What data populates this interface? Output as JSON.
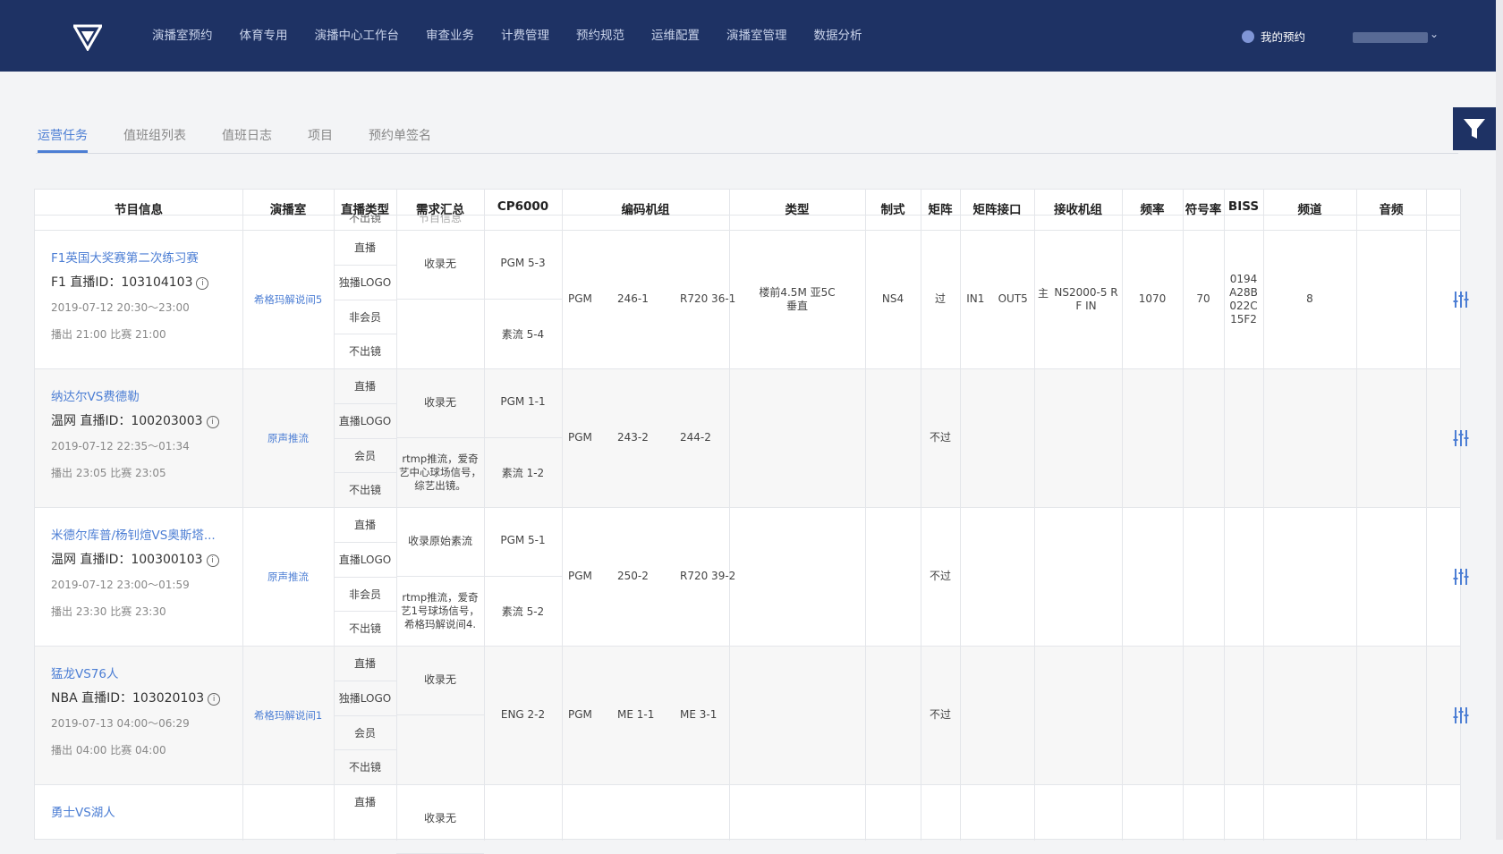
{
  "nav": {
    "items": [
      "演播室预约",
      "体育专用",
      "演播中心工作台",
      "审查业务",
      "计费管理",
      "预约规范",
      "运维配置",
      "演播室管理",
      "数据分析"
    ],
    "my_reservation": "我的预约"
  },
  "tabs": [
    "运营任务",
    "值班组列表",
    "值班日志",
    "项目",
    "预约单签名"
  ],
  "table": {
    "headers": [
      "节目信息",
      "演播室",
      "直播类型",
      "需求汇总",
      "CP6000",
      "编码机组",
      "类型",
      "制式",
      "矩阵",
      "矩阵接口",
      "接收机组",
      "频率",
      "符号率",
      "BISS",
      "频道",
      "音频"
    ],
    "cut_top": {
      "type": "不出镜",
      "req": "节目信息"
    },
    "rows": [
      {
        "title": "F1英国大奖赛第二次练习赛",
        "tag": "F1",
        "id_label": "直播ID：",
        "id": "103104103",
        "time": "2019-07-12 20:30～23:00",
        "play": "播出 21:00",
        "match": "比赛 21:00",
        "studio": "希格玛解说间5",
        "types": [
          "直播",
          "独播LOGO",
          "非会员",
          "不出镜"
        ],
        "req1": "收录无",
        "req2": "",
        "cp_top": {
          "label": "PGM",
          "value": "5-3"
        },
        "cp_bot": {
          "label": "素流",
          "value": "5-4"
        },
        "enc": {
          "a": "PGM",
          "b": "246-1",
          "c": "R720 36-1"
        },
        "kind": "楼前4.5M 亚5C\n垂直",
        "format": "NS4",
        "matrix": "过",
        "mif": {
          "in": "IN1",
          "out": "OUT5"
        },
        "recv": {
          "pre": "主",
          "val": "NS2000-5 R\nF IN"
        },
        "freq": "1070",
        "symrate": "70",
        "biss": "0194\nA28B\n022C\n15F2",
        "channel": "8",
        "audio": ""
      },
      {
        "title": "纳达尔VS费德勒",
        "tag": "温网",
        "id_label": "直播ID：",
        "id": "100203003",
        "time": "2019-07-12 22:35～01:34",
        "play": "播出 23:05",
        "match": "比赛 23:05",
        "studio": "原声推流",
        "types": [
          "直播",
          "直播LOGO",
          "会员",
          "不出镜"
        ],
        "req1": "收录无",
        "req2": "rtmp推流，爱奇\n艺中心球场信号，\n综艺出镜。",
        "cp_top": {
          "label": "PGM",
          "value": "1-1"
        },
        "cp_bot": {
          "label": "素流",
          "value": "1-2"
        },
        "enc": {
          "a": "PGM",
          "b": "243-2",
          "c": "244-2"
        },
        "kind": "",
        "format": "",
        "matrix": "不过",
        "mif": {
          "in": "",
          "out": ""
        },
        "recv": {
          "pre": "",
          "val": ""
        },
        "freq": "",
        "symrate": "",
        "biss": "",
        "channel": "",
        "audio": ""
      },
      {
        "title": "米德尔库普/杨钊煊VS奥斯塔...",
        "tag": "温网",
        "id_label": "直播ID：",
        "id": "100300103",
        "time": "2019-07-12 23:00～01:59",
        "play": "播出 23:30",
        "match": "比赛 23:30",
        "studio": "原声推流",
        "types": [
          "直播",
          "直播LOGO",
          "非会员",
          "不出镜"
        ],
        "req1": "收录原始素流",
        "req2": "rtmp推流，爱奇\n艺1号球场信号，\n希格玛解说间4.",
        "cp_top": {
          "label": "PGM",
          "value": "5-1"
        },
        "cp_bot": {
          "label": "素流",
          "value": "5-2"
        },
        "enc": {
          "a": "PGM",
          "b": "250-2",
          "c": "R720 39-2"
        },
        "kind": "",
        "format": "",
        "matrix": "不过",
        "mif": {
          "in": "",
          "out": ""
        },
        "recv": {
          "pre": "",
          "val": ""
        },
        "freq": "",
        "symrate": "",
        "biss": "",
        "channel": "",
        "audio": ""
      },
      {
        "title": "猛龙VS76人",
        "tag": "NBA",
        "id_label": "直播ID：",
        "id": "103020103",
        "time": "2019-07-13 04:00～06:29",
        "play": "播出 04:00",
        "match": "比赛 04:00",
        "studio": "希格玛解说间1",
        "types": [
          "直播",
          "独播LOGO",
          "会员",
          "不出镜"
        ],
        "req1": "收录无",
        "req2": "",
        "cp_single": {
          "label": "ENG",
          "value": "2-2"
        },
        "enc": {
          "a": "PGM",
          "b": "ME 1-1",
          "c": "ME 3-1"
        },
        "kind": "",
        "format": "",
        "matrix": "不过",
        "mif": {
          "in": "",
          "out": ""
        },
        "recv": {
          "pre": "",
          "val": ""
        },
        "freq": "",
        "symrate": "",
        "biss": "",
        "channel": "",
        "audio": ""
      },
      {
        "title": "勇士VS湖人",
        "types": [
          "直播"
        ],
        "req1": "收录无"
      }
    ]
  },
  "colors": {
    "nav_bg": "#1e3264",
    "accent": "#4c7ed4",
    "border": "#e4e6ea",
    "alt_row": "#f7f7f7"
  },
  "icons": {
    "filter": "filter-icon",
    "action": "sliders-icon",
    "info": "info-icon",
    "logo": "logo-icon"
  }
}
